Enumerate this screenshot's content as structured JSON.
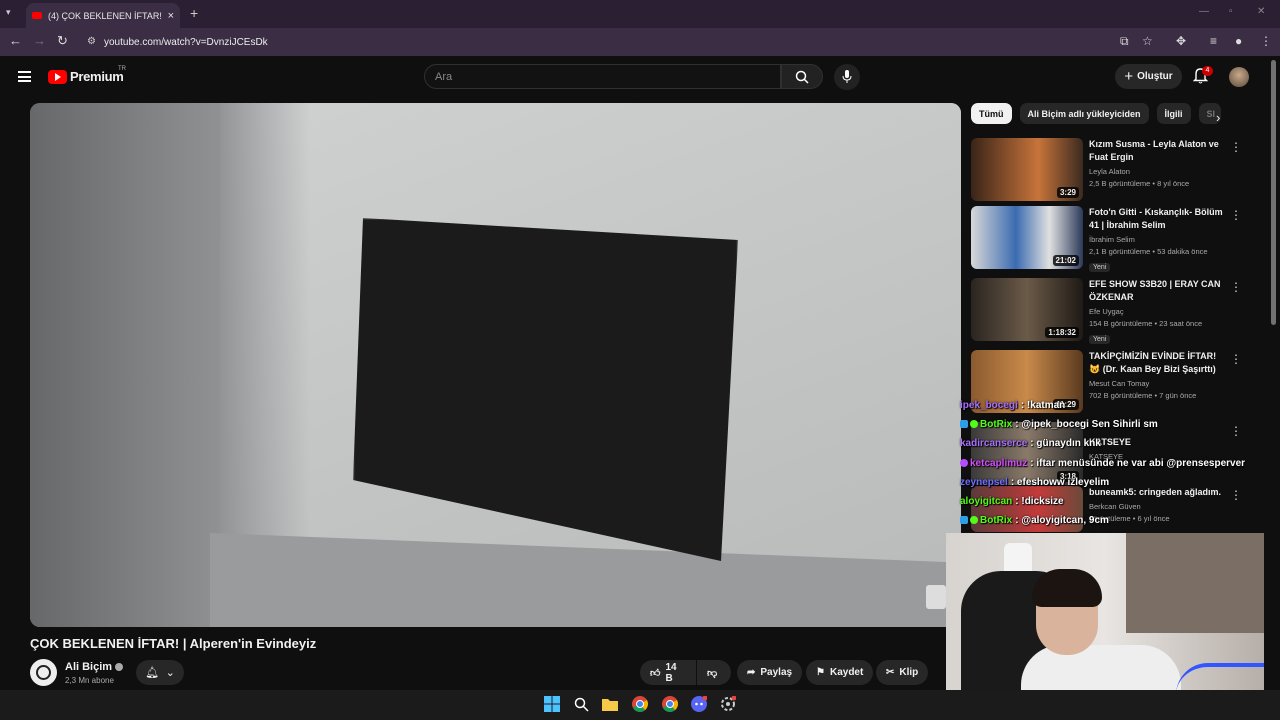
{
  "browser": {
    "tab_title": "(4) ÇOK BEKLENEN İFTAR! | Alpe",
    "url": "youtube.com/watch?v=DvnziJCEsDk"
  },
  "header": {
    "logo_text": "Premium",
    "logo_country": "TR",
    "search_placeholder": "Ara",
    "create_label": "Oluştur",
    "notif_count": "4"
  },
  "video": {
    "title": "ÇOK BEKLENEN İFTAR! | Alperen'in Evindeyiz",
    "channel": "Ali Biçim",
    "subscribers": "2,3 Mn abone",
    "likes": "14 B",
    "share_label": "Paylaş",
    "save_label": "Kaydet",
    "clip_label": "Klip"
  },
  "chips": [
    "Tümü",
    "Ali Biçim adlı yükleyiciden",
    "İlgili",
    "Sl"
  ],
  "recommendations": [
    {
      "title": "Kızım Susma - Leyla Alaton ve Fuat Ergin",
      "channel": "Leyla Alaton",
      "meta": "2,5 B görüntüleme • 8 yıl önce",
      "duration": "3:29",
      "badge": ""
    },
    {
      "title": "Foto'n Gitti - Kıskançlık- Bölüm 41 | İbrahim Selim",
      "channel": "İbrahim Selim",
      "meta": "2,1 B görüntüleme • 53 dakika önce",
      "duration": "21:02",
      "badge": "Yeni"
    },
    {
      "title": "EFE SHOW S3B20 | ERAY CAN ÖZKENAR",
      "channel": "Efe Uygaç",
      "meta": "154 B görüntüleme • 23 saat önce",
      "duration": "1:18:32",
      "badge": "Yeni"
    },
    {
      "title": "TAKİPÇİMİZİN EVİNDE İFTAR! 😺 (Dr. Kaan Bey Bizi Şaşırttı)",
      "channel": "Mesut Can Tomay",
      "meta": "702 B görüntüleme • 7 gün önce",
      "duration": "41:29",
      "badge": ""
    },
    {
      "title": "KATSEYE",
      "channel": "KATSEYE",
      "meta": "",
      "duration": "3:18",
      "badge": ""
    },
    {
      "title": "buneamk5: cringeden ağladım.",
      "channel": "Berkcan Güven",
      "meta": "görüntüleme • 6 yıl önce",
      "duration": "",
      "badge": ""
    }
  ],
  "chat": [
    {
      "user": "ipek_bocegi",
      "text": ": !katman",
      "color": "#a970ff"
    },
    {
      "user": "BotRix",
      "text": ": @ipek_bocegi Sen Sihirli   sm",
      "color": "#53fc18"
    },
    {
      "user": "kadircanserce",
      "text": ": günaydın knk",
      "color": "#a970ff"
    },
    {
      "user": "ketcaplimuz",
      "text": ": iftar menüsünde ne var abi @prensesperver",
      "color": "#d44dff"
    },
    {
      "user": "zeynepsel",
      "text": ": efeshoww izleyelim",
      "color": "#6f6fff"
    },
    {
      "user": "aloyigitcan",
      "text": ": !dicksize",
      "color": "#53fc18"
    },
    {
      "user": "BotRix",
      "text": ": @aloyigitcan, 9cm",
      "color": "#53fc18"
    }
  ]
}
